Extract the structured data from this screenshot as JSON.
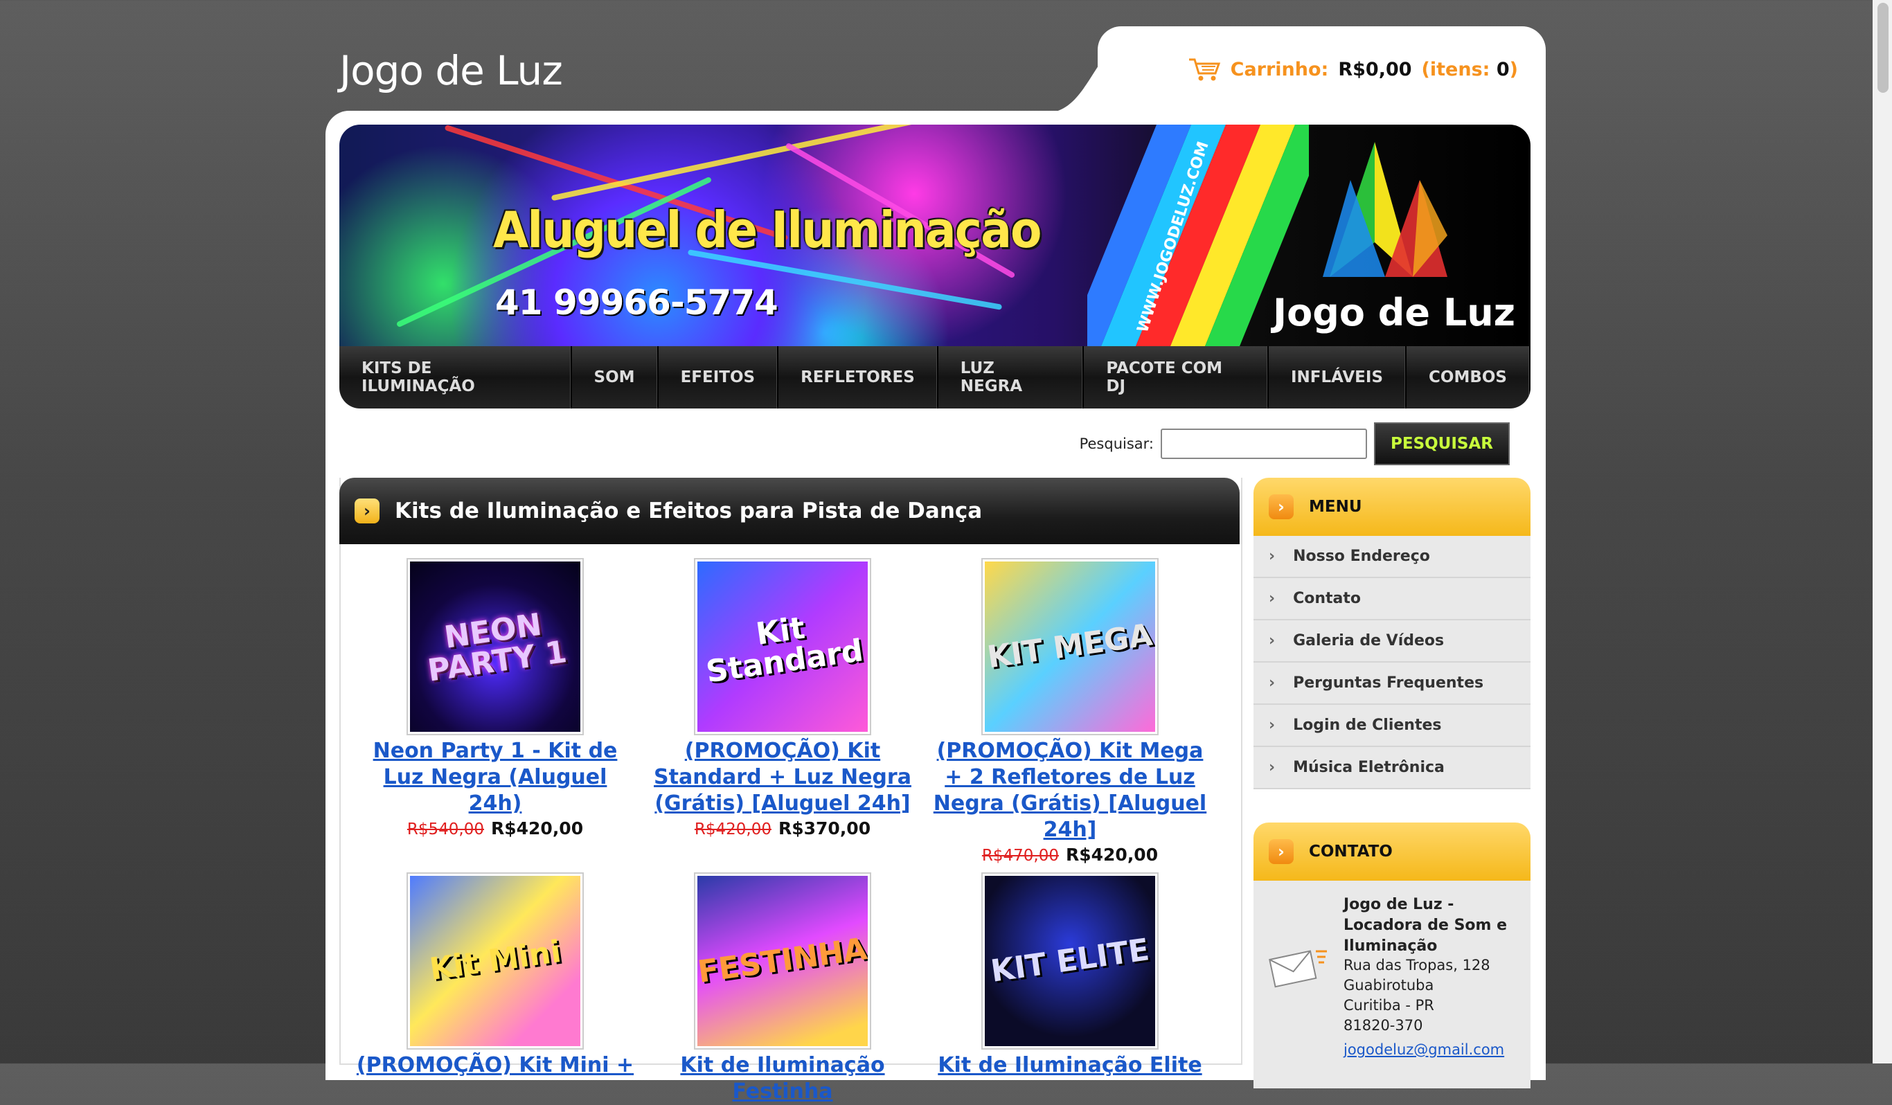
{
  "site": {
    "title": "Jogo de Luz"
  },
  "cart": {
    "label": "Carrinho:",
    "amount": "R$0,00",
    "items_open": "(itens:",
    "items_count": "0",
    "items_close": ")"
  },
  "banner": {
    "headline": "Aluguel de Iluminação",
    "phone": "41 99966-5774",
    "url": "WWW.JOGODELUZ.COM",
    "logo_text": "Jogo de Luz"
  },
  "nav": {
    "items": [
      "KITS DE ILUMINAÇÃO",
      "SOM",
      "EFEITOS",
      "REFLETORES",
      "LUZ NEGRA",
      "PACOTE COM DJ",
      "INFLÁVEIS",
      "COMBOS"
    ]
  },
  "search": {
    "label": "Pesquisar:",
    "value": "",
    "button": "PESQUISAR"
  },
  "content": {
    "title": "Kits de Iluminação e Efeitos para Pista de Dança",
    "products": [
      {
        "name": "Neon Party 1 - Kit de Luz Negra (Aluguel 24h)",
        "old_price": "R$540,00",
        "price": "R$420,00",
        "thumb_text": "NEON PARTY 1"
      },
      {
        "name": "(PROMOÇÃO) Kit Standard + Luz Negra (Grátis) [Aluguel 24h]",
        "old_price": "R$420,00",
        "price": "R$370,00",
        "thumb_text": "Kit Standard"
      },
      {
        "name": "(PROMOÇÃO) Kit Mega + 2 Refletores de Luz Negra (Grátis) [Aluguel 24h]",
        "old_price": "R$470,00",
        "price": "R$420,00",
        "thumb_text": "KIT MEGA"
      },
      {
        "name": "(PROMOÇÃO) Kit Mini +",
        "old_price": "",
        "price": "",
        "thumb_text": "Kit Mini"
      },
      {
        "name": "Kit de Iluminação Festinha",
        "old_price": "",
        "price": "",
        "thumb_text": "FESTINHA"
      },
      {
        "name": "Kit de Iluminação Elite",
        "old_price": "",
        "price": "",
        "thumb_text": "KIT ELITE"
      }
    ]
  },
  "sidebar": {
    "menu": {
      "title": "MENU",
      "items": [
        "Nosso Endereço",
        "Contato",
        "Galeria de Vídeos",
        "Perguntas Frequentes",
        "Login de Clientes",
        "Música Eletrônica"
      ]
    },
    "contact": {
      "title": "CONTATO",
      "name": "Jogo de Luz - Locadora de Som e Iluminação",
      "street": "Rua das Tropas, 128",
      "district": "Guabirotuba",
      "city": "Curitiba - PR",
      "zip": "81820-370",
      "email": "jogodeluz@gmail.com"
    }
  },
  "colors": {
    "accent_orange": "#f6921e",
    "link_blue": "#1a58c9",
    "sale_red": "#e02020",
    "search_button_text": "#c8ff3c"
  },
  "icons": [
    "cart-icon",
    "arrow-right-icon",
    "chevron-right-icon",
    "envelope-icon"
  ]
}
